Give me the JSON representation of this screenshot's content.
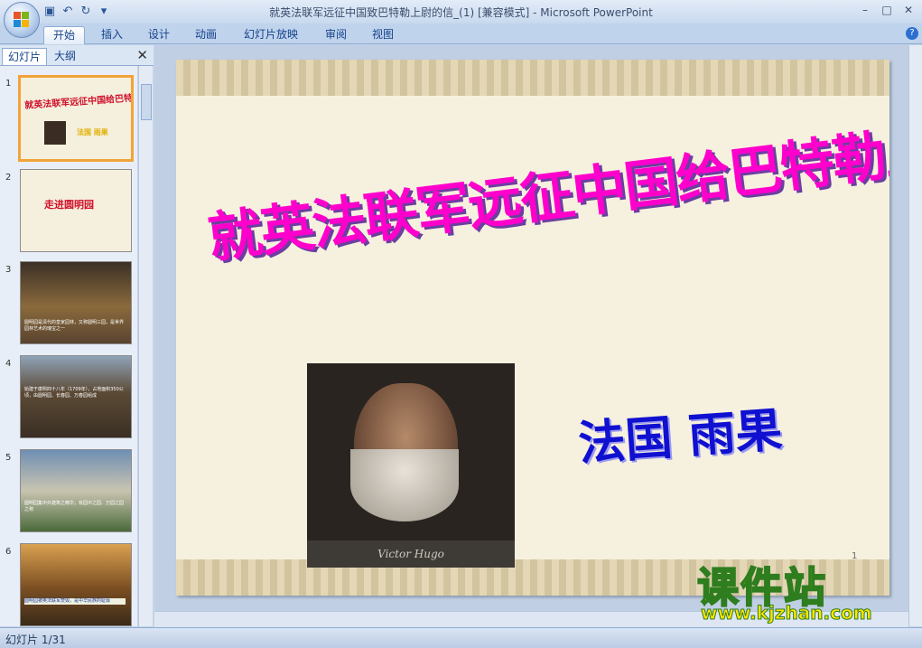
{
  "window": {
    "title": "就英法联军远征中国致巴特勒上尉的信_(1) [兼容模式] - Microsoft PowerPoint"
  },
  "ribbon": {
    "tabs": [
      "开始",
      "插入",
      "设计",
      "动画",
      "幻灯片放映",
      "审阅",
      "视图"
    ]
  },
  "pane": {
    "tabs": [
      "幻灯片",
      "大纲"
    ]
  },
  "thumbnails": [
    {
      "num": "1",
      "title": "就英法联军远征中国给巴特勒上尉的信",
      "subtitle": "法国 雨果"
    },
    {
      "num": "2",
      "title": "走进圆明园"
    },
    {
      "num": "3",
      "caption": "圆明园是清代的皇家园林，又称圆明三园，是世界园林艺术的瑰宝之一"
    },
    {
      "num": "4",
      "caption": "始建于康熙四十八年（1709年），占地面积350公顷，由圆明园、长春园、万春园组成"
    },
    {
      "num": "5",
      "caption": "圆明园集中外建筑之精华，有园中之园、万园之园之称"
    },
    {
      "num": "6",
      "caption": "圆明园被英法联军焚毁，是中华民族的耻辱"
    }
  ],
  "slide": {
    "title": "就英法联军远征中国给巴特勒上尉的信",
    "author": "法国 雨果",
    "photo_caption": "Victor Hugo",
    "number": "1"
  },
  "watermark": {
    "main": "课件站",
    "url": "www.kjzhan.com"
  },
  "status": {
    "slide_info": "幻灯片 1/31"
  }
}
